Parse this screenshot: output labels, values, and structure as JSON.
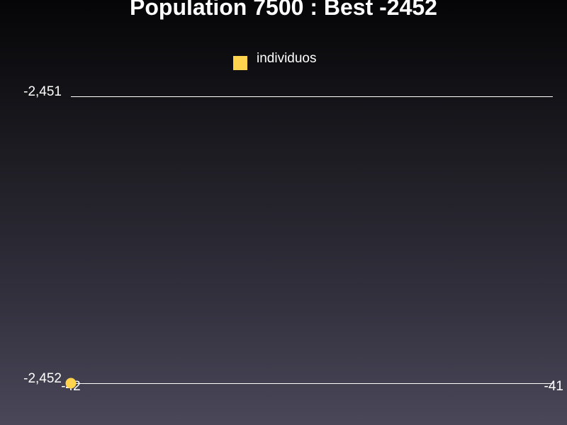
{
  "chart_data": {
    "type": "scatter",
    "title": "Population 7500 : Best -2452",
    "xlabel": "",
    "ylabel": "",
    "xlim": [
      -42,
      -41
    ],
    "ylim": [
      -2452,
      -2451
    ],
    "x_ticks": [
      {
        "value": -42,
        "label": "-42"
      },
      {
        "value": -41,
        "label": "-41"
      }
    ],
    "y_ticks": [
      {
        "value": -2451,
        "label": "-2,451"
      },
      {
        "value": -2452,
        "label": "-2,452"
      }
    ],
    "grid": "horizontal",
    "legend_position": "top-center",
    "series": [
      {
        "name": "individuos",
        "color": "#ffd34e",
        "points": [
          {
            "x": -42,
            "y": -2452
          }
        ]
      }
    ]
  }
}
